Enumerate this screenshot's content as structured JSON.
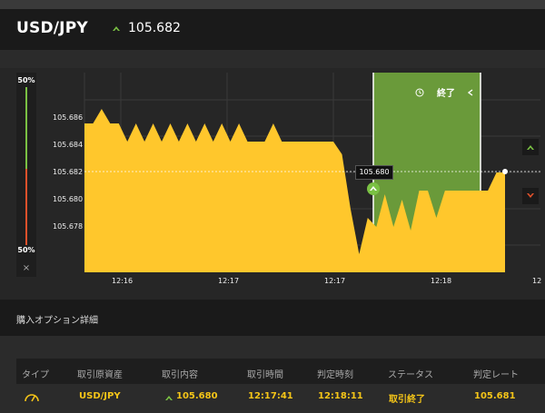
{
  "header": {
    "pair": "USD/JPY",
    "price": "105.682",
    "direction_icon": "up-arrow-icon"
  },
  "gauge": {
    "top_label": "50%",
    "bottom_label": "50%",
    "close_symbol": "×",
    "up_share": 0.5,
    "down_share": 0.5
  },
  "chart": {
    "end_label": "終了",
    "end_icon": "clock-icon",
    "callout": "105.680",
    "y_ticks": [
      "105.686",
      "105.684",
      "105.682",
      "105.680",
      "105.678"
    ],
    "x_ticks": [
      "12:16",
      "12:17",
      "12:17",
      "12:18",
      "12"
    ],
    "current_level": "105.682",
    "colors": {
      "area": "#ffc72c",
      "window": "#6a9a3a",
      "up": "#7ac143",
      "down": "#e0512b"
    }
  },
  "chart_data": {
    "type": "area",
    "x": [
      "12:16",
      "12:17",
      "12:17",
      "12:18"
    ],
    "ylim": [
      105.6765,
      105.6875
    ],
    "y_ticks": [
      105.686,
      105.684,
      105.682,
      105.68,
      105.678
    ],
    "series": [
      {
        "values": [
          105.6847,
          105.6847,
          105.6855,
          105.6847,
          105.6847,
          105.6837,
          105.6847,
          105.6837,
          105.6847,
          105.6837,
          105.6847,
          105.6837,
          105.6847,
          105.6837,
          105.6847,
          105.6837,
          105.6847,
          105.6837,
          105.6847,
          105.6837,
          105.6837,
          105.6837,
          105.6847,
          105.6837,
          105.6837,
          105.6837,
          105.6837,
          105.6837,
          105.6837,
          105.6837,
          105.683,
          105.68,
          105.6775,
          105.6795,
          105.679,
          105.6808,
          105.679,
          105.6805,
          105.6788,
          105.681,
          105.681,
          105.6795,
          105.681,
          105.681,
          105.681,
          105.681,
          105.681,
          105.681,
          105.682,
          105.682
        ]
      }
    ]
  },
  "side_buttons": {
    "up_icon": "up-arrow-icon",
    "down_icon": "down-arrow-icon"
  },
  "details": {
    "title": "購入オプション詳細",
    "columns": [
      "タイプ",
      "取引原資産",
      "取引内容",
      "取引時間",
      "判定時刻",
      "ステータス",
      "判定レート"
    ],
    "row": {
      "type_icon": "speedometer-icon",
      "asset": "USD/JPY",
      "content_icon": "up-arrow-icon",
      "content": "105.680",
      "trade_time": "12:17:41",
      "judge_time": "12:18:11",
      "status": "取引終了",
      "rate": "105.681"
    }
  }
}
